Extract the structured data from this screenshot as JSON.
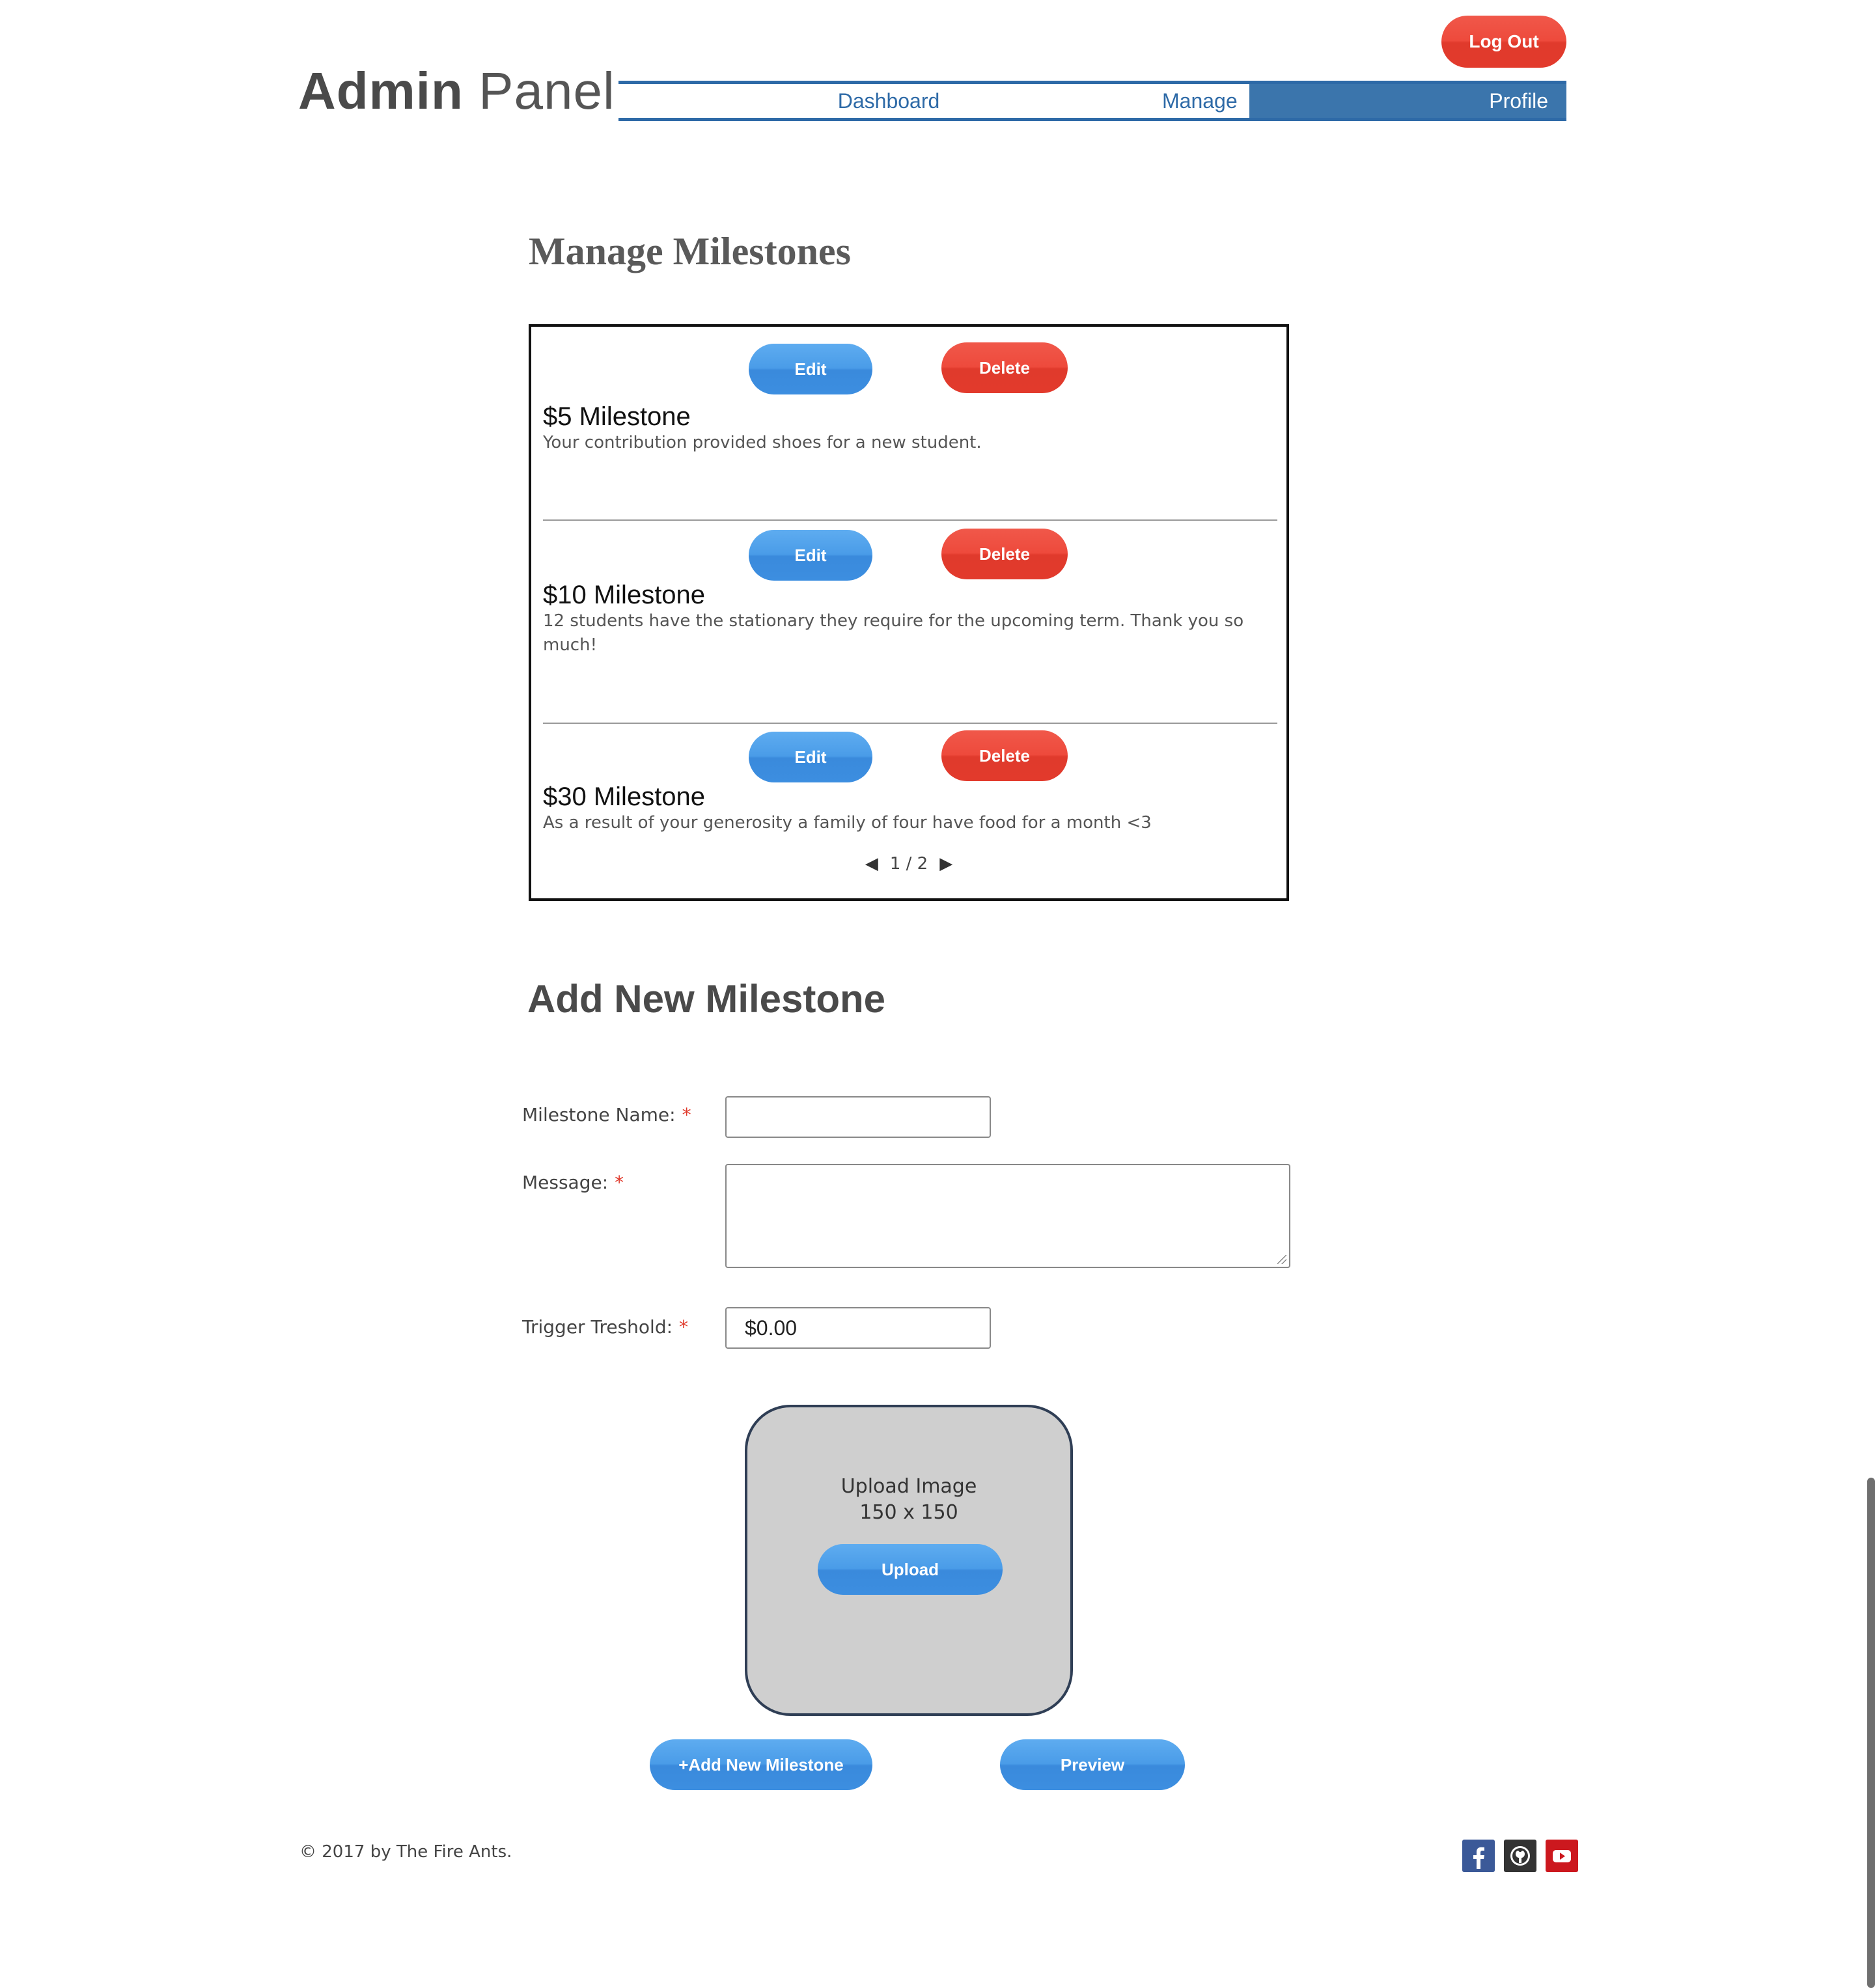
{
  "header": {
    "title_bold": "Admin",
    "title_light": " Panel",
    "logout_label": "Log Out",
    "nav": [
      {
        "label": "Dashboard"
      },
      {
        "label": "Manage"
      },
      {
        "label": "Profile"
      }
    ],
    "active_nav": "Profile"
  },
  "manage": {
    "title": "Manage Milestones",
    "edit_label": "Edit",
    "delete_label": "Delete",
    "milestones": [
      {
        "title": "$5 Milestone",
        "description": "Your contribution provided shoes for a new student."
      },
      {
        "title": "$10 Milestone",
        "description": "12 students have the stationary they require for the upcoming term. Thank you so much!"
      },
      {
        "title": "$30 Milestone",
        "description": "As a result of your generosity a family of four have food for a month <3"
      }
    ],
    "pager": {
      "current": "1",
      "separator": "/",
      "total": "2",
      "text": "1 / 2"
    }
  },
  "form": {
    "title": "Add New Milestone",
    "name_label": "Milestone Name:",
    "name_value": "",
    "message_label": "Message:",
    "message_value": "",
    "threshold_label": "Trigger Treshold:",
    "threshold_value": "$0.00",
    "required_marker": "*",
    "upload": {
      "line1": "Upload Image",
      "line2": "150 x 150",
      "button_label": "Upload"
    },
    "add_button_label": "+Add New Milestone",
    "preview_button_label": "Preview"
  },
  "footer": {
    "copyright": "© 2017 by The Fire Ants.",
    "social": [
      {
        "icon": "facebook-icon",
        "color": "#3b5998"
      },
      {
        "icon": "github-icon",
        "color": "#333333"
      },
      {
        "icon": "youtube-icon",
        "color": "#cc181e"
      }
    ]
  },
  "colors": {
    "accent_blue": "#2e6aa7",
    "nav_active_bg": "#3b75ac",
    "button_blue": "#4a9ce8",
    "button_red": "#ee4a3c",
    "upload_card_bg": "#cfcfcf"
  }
}
